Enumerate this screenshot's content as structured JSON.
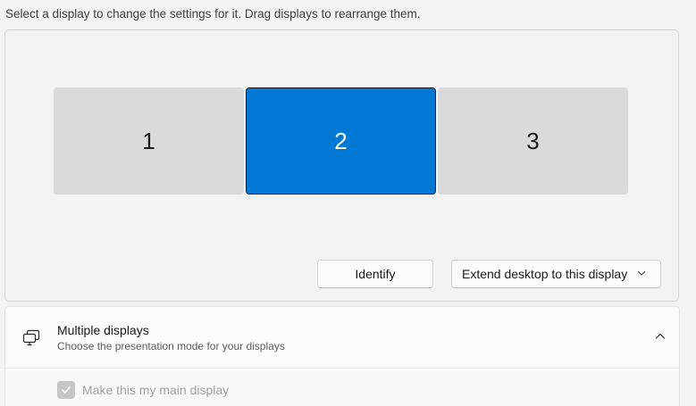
{
  "instruction": "Select a display to change the settings for it. Drag displays to rearrange them.",
  "displays": [
    {
      "label": "1",
      "selected": false
    },
    {
      "label": "2",
      "selected": true
    },
    {
      "label": "3",
      "selected": false
    }
  ],
  "actions": {
    "identify_label": "Identify",
    "mode_dropdown": {
      "selected": "Extend desktop to this display",
      "icon": "chevron-down-icon"
    }
  },
  "multiple_displays": {
    "title": "Multiple displays",
    "subtitle": "Choose the presentation mode for your displays",
    "expanded": true,
    "icon": "multiple-displays-icon",
    "options": {
      "main_display": {
        "label": "Make this my main display",
        "checked": true,
        "disabled": true
      }
    }
  },
  "colors": {
    "accent": "#0078d4",
    "background": "#f3f3f3",
    "monitor_unselected": "#dadada",
    "card": "#fbfbfb"
  }
}
